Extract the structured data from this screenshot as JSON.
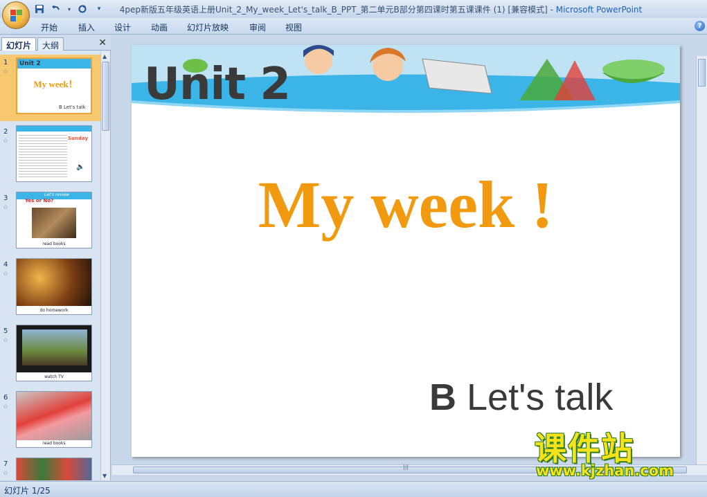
{
  "window": {
    "title": "4pep新版五年级英语上册Unit_2_My_week_Let's_talk_B_PPT_第二单元B部分第四课时第五课课件 (1) [兼容模式]",
    "separator": " - ",
    "app_name": "Microsoft PowerPoint"
  },
  "ribbon": {
    "tabs": [
      "开始",
      "插入",
      "设计",
      "动画",
      "幻灯片放映",
      "审阅",
      "视图"
    ]
  },
  "left_pane": {
    "tabs": [
      "幻灯片",
      "大纲"
    ],
    "slides": [
      {
        "number": "1",
        "title": "My week！",
        "unit": "Unit 2",
        "caption": "B Let's talk"
      },
      {
        "number": "2",
        "caption": "",
        "title": "Sunday"
      },
      {
        "number": "3",
        "caption": "read books",
        "title": "Let's review",
        "tag": "Yes or No?"
      },
      {
        "number": "4",
        "caption": "do homework"
      },
      {
        "number": "5",
        "caption": "watch TV"
      },
      {
        "number": "6",
        "caption": "read books"
      },
      {
        "number": "7",
        "caption": ""
      }
    ]
  },
  "slide": {
    "unit_title": "Unit 2",
    "main_title": "My week !",
    "subtitle_bold": "B",
    "subtitle_rest": " Let's talk"
  },
  "watermark": {
    "title": "课件站",
    "url": "www.kjzhan.com"
  },
  "statusbar": {
    "slide_indicator": "幻灯片 1/25"
  },
  "colors": {
    "title_orange": "#f29a0f",
    "banner_blue": "#3bb5e8",
    "selection": "#f7c86d"
  }
}
